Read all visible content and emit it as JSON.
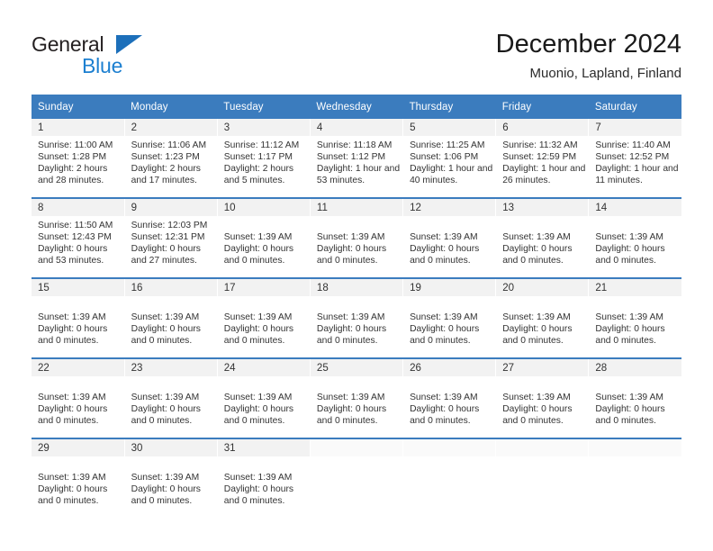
{
  "brand": {
    "name_part1": "General",
    "name_part2": "Blue",
    "triangle_icon": "triangle-logo-icon"
  },
  "header": {
    "title": "December 2024",
    "subtitle": "Muonio, Lapland, Finland"
  },
  "colors": {
    "header_blue": "#3b7cbe",
    "brand_blue": "#1c7fd0",
    "daynum_band": "#f2f2f2",
    "text": "#333333"
  },
  "calendar": {
    "weekday_headers": [
      "Sunday",
      "Monday",
      "Tuesday",
      "Wednesday",
      "Thursday",
      "Friday",
      "Saturday"
    ],
    "weeks": [
      [
        {
          "day": "1",
          "sunrise": "Sunrise: 11:00 AM",
          "sunset": "Sunset: 1:28 PM",
          "daylight1": "Daylight: 2 hours",
          "daylight2": "and 28 minutes."
        },
        {
          "day": "2",
          "sunrise": "Sunrise: 11:06 AM",
          "sunset": "Sunset: 1:23 PM",
          "daylight1": "Daylight: 2 hours",
          "daylight2": "and 17 minutes."
        },
        {
          "day": "3",
          "sunrise": "Sunrise: 11:12 AM",
          "sunset": "Sunset: 1:17 PM",
          "daylight1": "Daylight: 2 hours",
          "daylight2": "and 5 minutes."
        },
        {
          "day": "4",
          "sunrise": "Sunrise: 11:18 AM",
          "sunset": "Sunset: 1:12 PM",
          "daylight1": "Daylight: 1 hour and",
          "daylight2": "53 minutes."
        },
        {
          "day": "5",
          "sunrise": "Sunrise: 11:25 AM",
          "sunset": "Sunset: 1:06 PM",
          "daylight1": "Daylight: 1 hour and",
          "daylight2": "40 minutes."
        },
        {
          "day": "6",
          "sunrise": "Sunrise: 11:32 AM",
          "sunset": "Sunset: 12:59 PM",
          "daylight1": "Daylight: 1 hour and",
          "daylight2": "26 minutes."
        },
        {
          "day": "7",
          "sunrise": "Sunrise: 11:40 AM",
          "sunset": "Sunset: 12:52 PM",
          "daylight1": "Daylight: 1 hour and",
          "daylight2": "11 minutes."
        }
      ],
      [
        {
          "day": "8",
          "sunrise": "Sunrise: 11:50 AM",
          "sunset": "Sunset: 12:43 PM",
          "daylight1": "Daylight: 0 hours",
          "daylight2": "and 53 minutes."
        },
        {
          "day": "9",
          "sunrise": "Sunrise: 12:03 PM",
          "sunset": "Sunset: 12:31 PM",
          "daylight1": "Daylight: 0 hours",
          "daylight2": "and 27 minutes."
        },
        {
          "day": "10",
          "sunrise": "",
          "sunset": "Sunset: 1:39 AM",
          "daylight1": "Daylight: 0 hours",
          "daylight2": "and 0 minutes."
        },
        {
          "day": "11",
          "sunrise": "",
          "sunset": "Sunset: 1:39 AM",
          "daylight1": "Daylight: 0 hours",
          "daylight2": "and 0 minutes."
        },
        {
          "day": "12",
          "sunrise": "",
          "sunset": "Sunset: 1:39 AM",
          "daylight1": "Daylight: 0 hours",
          "daylight2": "and 0 minutes."
        },
        {
          "day": "13",
          "sunrise": "",
          "sunset": "Sunset: 1:39 AM",
          "daylight1": "Daylight: 0 hours",
          "daylight2": "and 0 minutes."
        },
        {
          "day": "14",
          "sunrise": "",
          "sunset": "Sunset: 1:39 AM",
          "daylight1": "Daylight: 0 hours",
          "daylight2": "and 0 minutes."
        }
      ],
      [
        {
          "day": "15",
          "sunrise": "",
          "sunset": "Sunset: 1:39 AM",
          "daylight1": "Daylight: 0 hours",
          "daylight2": "and 0 minutes."
        },
        {
          "day": "16",
          "sunrise": "",
          "sunset": "Sunset: 1:39 AM",
          "daylight1": "Daylight: 0 hours",
          "daylight2": "and 0 minutes."
        },
        {
          "day": "17",
          "sunrise": "",
          "sunset": "Sunset: 1:39 AM",
          "daylight1": "Daylight: 0 hours",
          "daylight2": "and 0 minutes."
        },
        {
          "day": "18",
          "sunrise": "",
          "sunset": "Sunset: 1:39 AM",
          "daylight1": "Daylight: 0 hours",
          "daylight2": "and 0 minutes."
        },
        {
          "day": "19",
          "sunrise": "",
          "sunset": "Sunset: 1:39 AM",
          "daylight1": "Daylight: 0 hours",
          "daylight2": "and 0 minutes."
        },
        {
          "day": "20",
          "sunrise": "",
          "sunset": "Sunset: 1:39 AM",
          "daylight1": "Daylight: 0 hours",
          "daylight2": "and 0 minutes."
        },
        {
          "day": "21",
          "sunrise": "",
          "sunset": "Sunset: 1:39 AM",
          "daylight1": "Daylight: 0 hours",
          "daylight2": "and 0 minutes."
        }
      ],
      [
        {
          "day": "22",
          "sunrise": "",
          "sunset": "Sunset: 1:39 AM",
          "daylight1": "Daylight: 0 hours",
          "daylight2": "and 0 minutes."
        },
        {
          "day": "23",
          "sunrise": "",
          "sunset": "Sunset: 1:39 AM",
          "daylight1": "Daylight: 0 hours",
          "daylight2": "and 0 minutes."
        },
        {
          "day": "24",
          "sunrise": "",
          "sunset": "Sunset: 1:39 AM",
          "daylight1": "Daylight: 0 hours",
          "daylight2": "and 0 minutes."
        },
        {
          "day": "25",
          "sunrise": "",
          "sunset": "Sunset: 1:39 AM",
          "daylight1": "Daylight: 0 hours",
          "daylight2": "and 0 minutes."
        },
        {
          "day": "26",
          "sunrise": "",
          "sunset": "Sunset: 1:39 AM",
          "daylight1": "Daylight: 0 hours",
          "daylight2": "and 0 minutes."
        },
        {
          "day": "27",
          "sunrise": "",
          "sunset": "Sunset: 1:39 AM",
          "daylight1": "Daylight: 0 hours",
          "daylight2": "and 0 minutes."
        },
        {
          "day": "28",
          "sunrise": "",
          "sunset": "Sunset: 1:39 AM",
          "daylight1": "Daylight: 0 hours",
          "daylight2": "and 0 minutes."
        }
      ],
      [
        {
          "day": "29",
          "sunrise": "",
          "sunset": "Sunset: 1:39 AM",
          "daylight1": "Daylight: 0 hours",
          "daylight2": "and 0 minutes."
        },
        {
          "day": "30",
          "sunrise": "",
          "sunset": "Sunset: 1:39 AM",
          "daylight1": "Daylight: 0 hours",
          "daylight2": "and 0 minutes."
        },
        {
          "day": "31",
          "sunrise": "",
          "sunset": "Sunset: 1:39 AM",
          "daylight1": "Daylight: 0 hours",
          "daylight2": "and 0 minutes."
        },
        {
          "day": "",
          "sunrise": "",
          "sunset": "",
          "daylight1": "",
          "daylight2": ""
        },
        {
          "day": "",
          "sunrise": "",
          "sunset": "",
          "daylight1": "",
          "daylight2": ""
        },
        {
          "day": "",
          "sunrise": "",
          "sunset": "",
          "daylight1": "",
          "daylight2": ""
        },
        {
          "day": "",
          "sunrise": "",
          "sunset": "",
          "daylight1": "",
          "daylight2": ""
        }
      ]
    ]
  }
}
